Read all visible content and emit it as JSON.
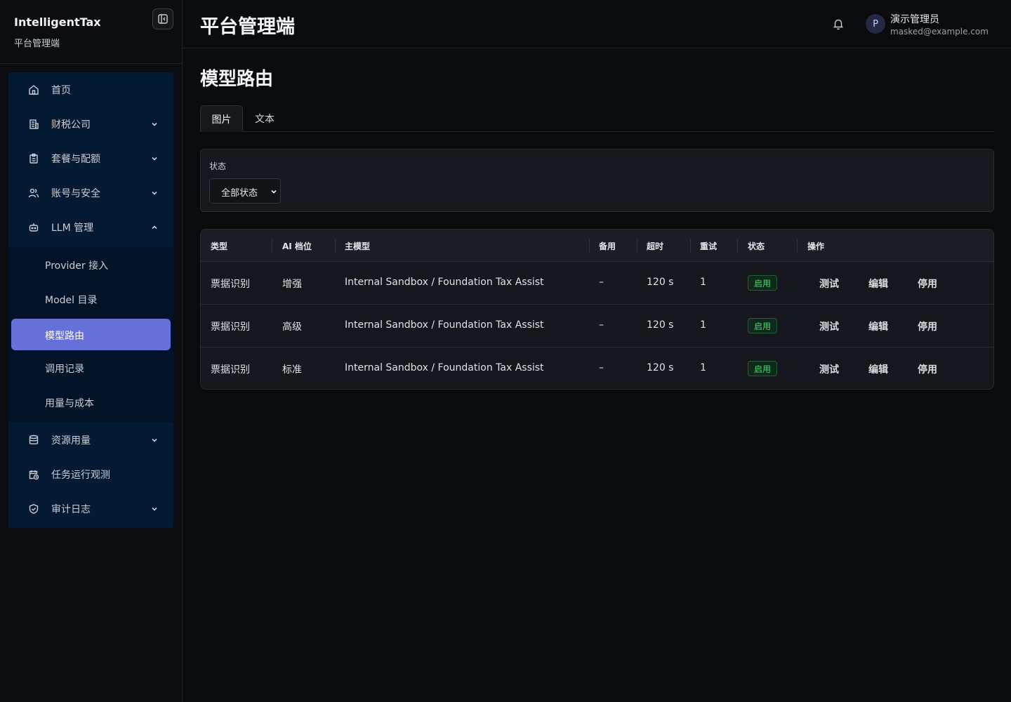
{
  "sidebar": {
    "brand_title": "IntelligentTax",
    "brand_sub": "平台管理端",
    "items": [
      {
        "label": "首页",
        "icon": "home-icon"
      },
      {
        "label": "财税公司",
        "icon": "building-icon"
      },
      {
        "label": "套餐与配额",
        "icon": "clipboard-icon"
      },
      {
        "label": "账号与安全",
        "icon": "users-icon"
      },
      {
        "label": "LLM 管理",
        "icon": "bot-icon"
      },
      {
        "label": "资源用量",
        "icon": "database-icon"
      },
      {
        "label": "任务运行观测",
        "icon": "calendar-clock-icon"
      },
      {
        "label": "审计日志",
        "icon": "shield-check-icon"
      }
    ],
    "sub_items": [
      {
        "label": "Provider 接入"
      },
      {
        "label": "Model 目录"
      },
      {
        "label": "模型路由"
      },
      {
        "label": "调用记录"
      },
      {
        "label": "用量与成本"
      }
    ]
  },
  "header": {
    "title": "平台管理端",
    "avatar_letter": "P",
    "user_name": "演示管理员",
    "user_email": "masked@example.com"
  },
  "main": {
    "page_title": "模型路由",
    "tabs": [
      {
        "label": "图片"
      },
      {
        "label": "文本"
      }
    ],
    "filter": {
      "label": "状态",
      "value": "全部状态"
    },
    "table": {
      "headers": [
        "类型",
        "AI 档位",
        "主模型",
        "备用",
        "超时",
        "重试",
        "状态",
        "操作"
      ],
      "rows": [
        {
          "type": "票据识别",
          "tier": "增强",
          "model": "Internal Sandbox / Foundation Tax Assist",
          "fallback": "–",
          "timeout": "120 s",
          "retry": "1",
          "status": "启用",
          "actions": [
            "测试",
            "编辑",
            "停用"
          ]
        },
        {
          "type": "票据识别",
          "tier": "高级",
          "model": "Internal Sandbox / Foundation Tax Assist",
          "fallback": "–",
          "timeout": "120 s",
          "retry": "1",
          "status": "启用",
          "actions": [
            "测试",
            "编辑",
            "停用"
          ]
        },
        {
          "type": "票据识别",
          "tier": "标准",
          "model": "Internal Sandbox / Foundation Tax Assist",
          "fallback": "–",
          "timeout": "120 s",
          "retry": "1",
          "status": "启用",
          "actions": [
            "测试",
            "编辑",
            "停用"
          ]
        }
      ]
    }
  },
  "colors": {
    "accent": "#6670d9",
    "nav_bg": "#041a33",
    "status_green": "#4fd47a"
  }
}
